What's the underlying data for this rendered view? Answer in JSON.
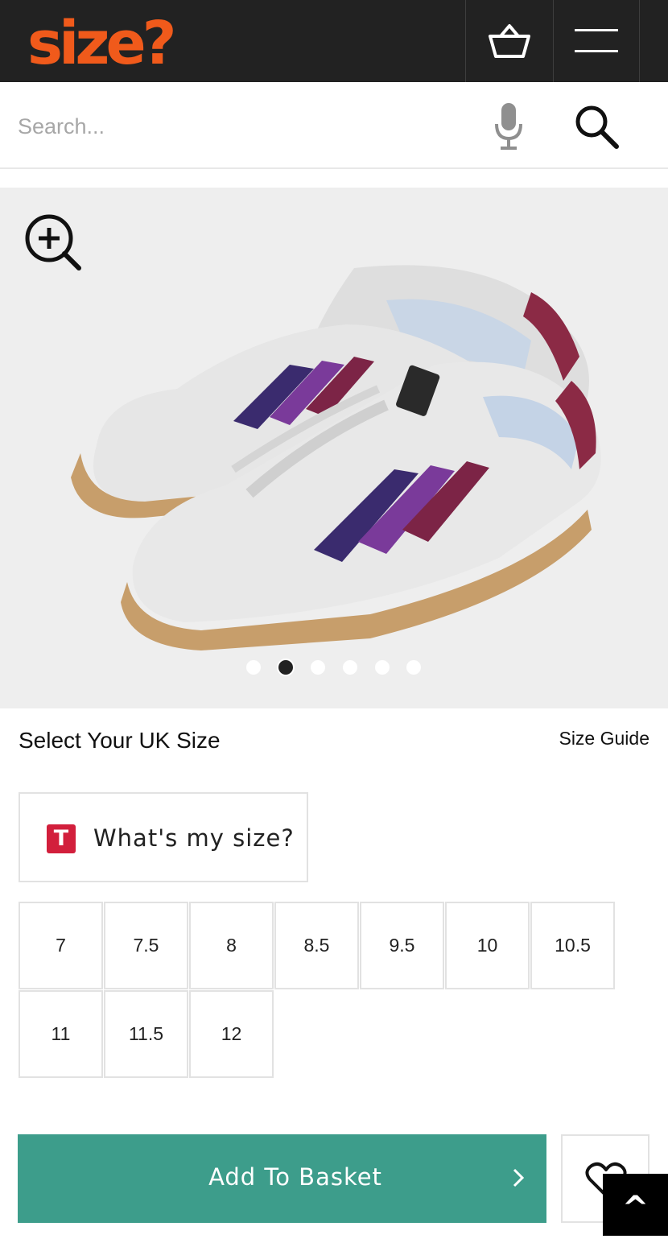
{
  "header": {
    "logo_text": "size?",
    "brand_color": "#f05a1b",
    "basket_icon": "basket-icon",
    "menu_icon": "hamburger-menu-icon"
  },
  "search": {
    "placeholder": "Search...",
    "mic_icon": "microphone-icon",
    "search_icon": "magnifier-icon"
  },
  "gallery": {
    "zoom_icon": "zoom-in-icon",
    "image_alt": "white trainer pair with purple and burgundy stripes and gum sole",
    "slide_count": 6,
    "active_slide": 2
  },
  "size_selector": {
    "heading": "Select Your UK Size",
    "guide_link": "Size Guide",
    "fit_button_logo": "T",
    "fit_button_label": "What's my size?",
    "sizes": [
      "7",
      "7.5",
      "8",
      "8.5",
      "9.5",
      "10",
      "10.5",
      "11",
      "11.5",
      "12"
    ]
  },
  "actions": {
    "add_to_basket": "Add To Basket",
    "add_color": "#3d9d8b",
    "wishlist_icon": "heart-icon",
    "back_to_top": "^"
  }
}
